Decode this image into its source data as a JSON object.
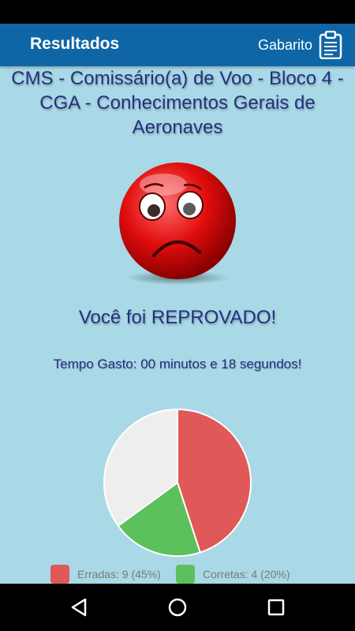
{
  "app_bar": {
    "title": "Resultados",
    "gabarito_label": "Gabarito"
  },
  "exam": {
    "title": "CMS - Comissário(a) de Voo - Bloco 4 - CGA - Conhecimentos Gerais de Aeronaves"
  },
  "result": {
    "status_text": "Você foi REPROVADO!",
    "time_text": "Tempo Gasto: 00 minutos e 18 segundos!"
  },
  "chart_data": {
    "type": "pie",
    "slices": [
      {
        "label": "Erradas",
        "value": 9,
        "percent": 45,
        "color": "#e05858"
      },
      {
        "label": "Corretas",
        "value": 4,
        "percent": 20,
        "color": "#5cc05c"
      },
      {
        "label": "",
        "value": 7,
        "percent": 35,
        "color": "#eeeeee"
      }
    ]
  },
  "legend": [
    {
      "text": "Erradas: 9 (45%)",
      "color": "#e05858"
    },
    {
      "text": "Corretas: 4 (20%)",
      "color": "#5cc05c"
    }
  ],
  "icons": {
    "gabarito": "clipboard-icon",
    "nav_back": "back-triangle-icon",
    "nav_home": "home-circle-icon",
    "nav_recents": "recents-square-icon",
    "face": "sad-face-icon"
  }
}
